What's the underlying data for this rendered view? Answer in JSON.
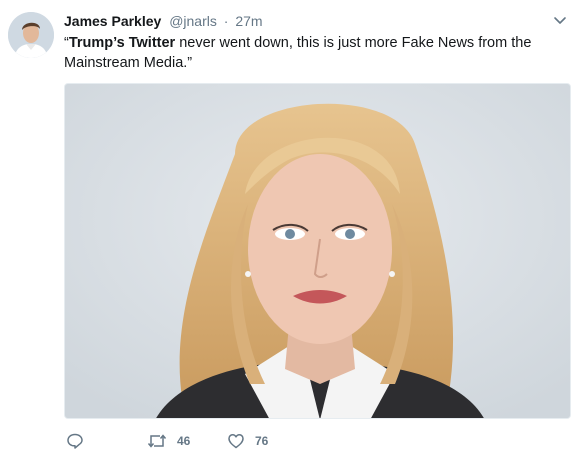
{
  "tweet": {
    "author_name": "James Parkley",
    "author_handle": "@jnarls",
    "separator": "·",
    "time": "27m",
    "text_quote_open": "“",
    "text_bold": "Trump’s Twitter",
    "text_rest": " never went down, this is just more Fake News from the Mainstream Media.”"
  },
  "actions": {
    "reply_icon": "reply-icon",
    "retweet_icon": "retweet-icon",
    "retweet_count": "46",
    "like_icon": "heart-icon",
    "like_count": "76"
  },
  "colors": {
    "text": "#14171a",
    "secondary": "#657786",
    "photo_background": "#d8dde2"
  }
}
